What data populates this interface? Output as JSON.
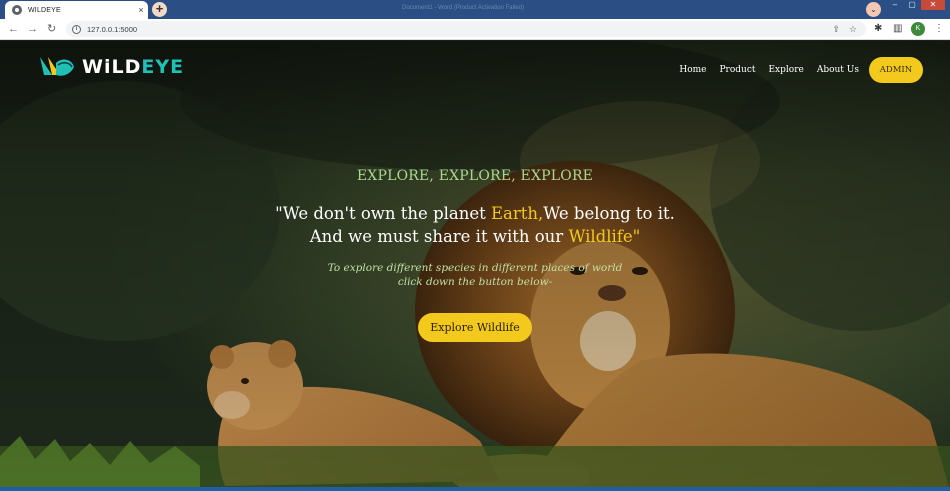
{
  "browser": {
    "tab_title": "WILDEYE",
    "tab_close": "×",
    "new_tab": "+",
    "background_window_title": "Document1 - Word (Product Activation Failed)",
    "url": "127.0.0.1:5000",
    "account_initial": "K"
  },
  "site": {
    "logo_part_1": "WiLD",
    "logo_part_2": "EYE",
    "nav": [
      "Home",
      "Product",
      "Explore",
      "About Us"
    ],
    "admin_label": "ADMIN"
  },
  "hero": {
    "eyebrow": "EXPLORE, EXPLORE, EXPLORE",
    "quote_part_1": "\"We don't own the planet ",
    "quote_highlight_1": "Earth,",
    "quote_part_2": "We belong to it.",
    "quote_part_3": "And we must share it with our ",
    "quote_highlight_2": "Wildlife",
    "quote_part_4": "\"",
    "tagline_line_1": "To explore different species in different places of world",
    "tagline_line_2": "click down the button below-",
    "cta_label": "Explore Wildlife"
  },
  "colors": {
    "accent": "#f2c91c",
    "logo_teal": "#20c0b7",
    "eyebrow_green": "#a9d98f",
    "browser_frame": "#2b4f84"
  },
  "icons": [
    "globe-icon",
    "back-arrow-icon",
    "forward-arrow-icon",
    "reload-icon",
    "info-icon",
    "share-icon",
    "star-icon",
    "puzzle-icon",
    "sidepanel-icon",
    "kebab-menu-icon"
  ]
}
